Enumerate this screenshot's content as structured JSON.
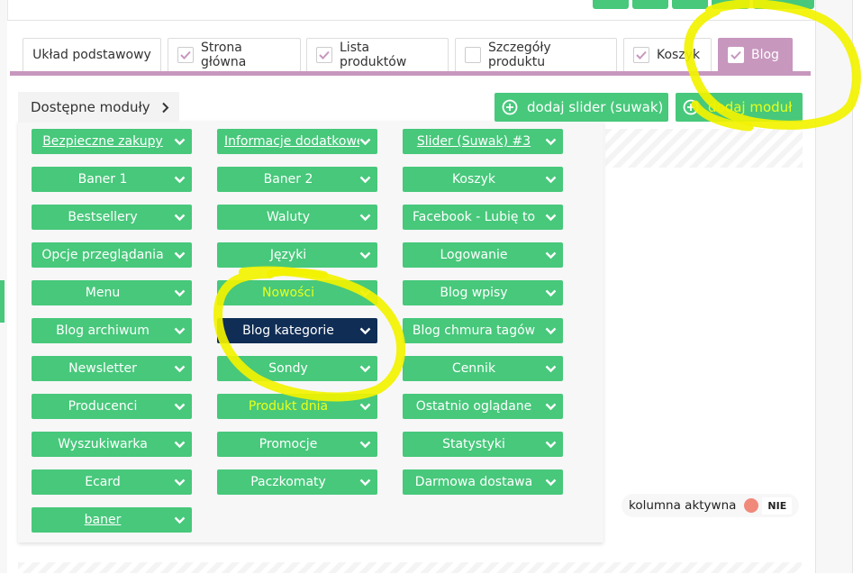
{
  "tabs": [
    {
      "label": "Układ podstawowy",
      "checked": null
    },
    {
      "label": "Strona główna",
      "checked": true
    },
    {
      "label": "Lista produktów",
      "checked": true
    },
    {
      "label": "Szczegóły produktu",
      "checked": false
    },
    {
      "label": "Koszyk",
      "checked": true
    },
    {
      "label": "Blog",
      "checked": true,
      "active": true
    }
  ],
  "modules_header": "Dostępne moduły",
  "actions": {
    "add_slider": "dodaj slider (suwak)",
    "add_module": "dodaj moduł"
  },
  "modules": [
    [
      "Bezpieczne zakupy",
      "Informacje dodatkowe",
      "Slider (Suwak) #3"
    ],
    [
      "Baner 1",
      "Baner 2",
      "Koszyk"
    ],
    [
      "Bestsellery",
      "Waluty",
      "Facebook - Lubię to"
    ],
    [
      "Opcje przeglądania",
      "Języki",
      "Logowanie"
    ],
    [
      "Menu",
      "Nowości",
      "Blog wpisy"
    ],
    [
      "Blog archiwum",
      "Blog kategorie",
      "Blog chmura tagów"
    ],
    [
      "Newsletter",
      "Sondy",
      "Cennik"
    ],
    [
      "Producenci",
      "Produkt dnia",
      "Ostatnio oglądane"
    ],
    [
      "Wyszukiwarka",
      "Promocje",
      "Statystyki"
    ],
    [
      "Ecard",
      "Paczkomaty",
      "Darmowa dostawa"
    ],
    [
      "baner"
    ]
  ],
  "column_status": {
    "label": "kolumna aktywna",
    "value": "NIE"
  },
  "colors": {
    "green": "#47c87b",
    "tab_active": "#c797be",
    "selected_module": "#0f2d55",
    "highlight": "#f2f200",
    "inactive_dot": "#f0897a"
  }
}
